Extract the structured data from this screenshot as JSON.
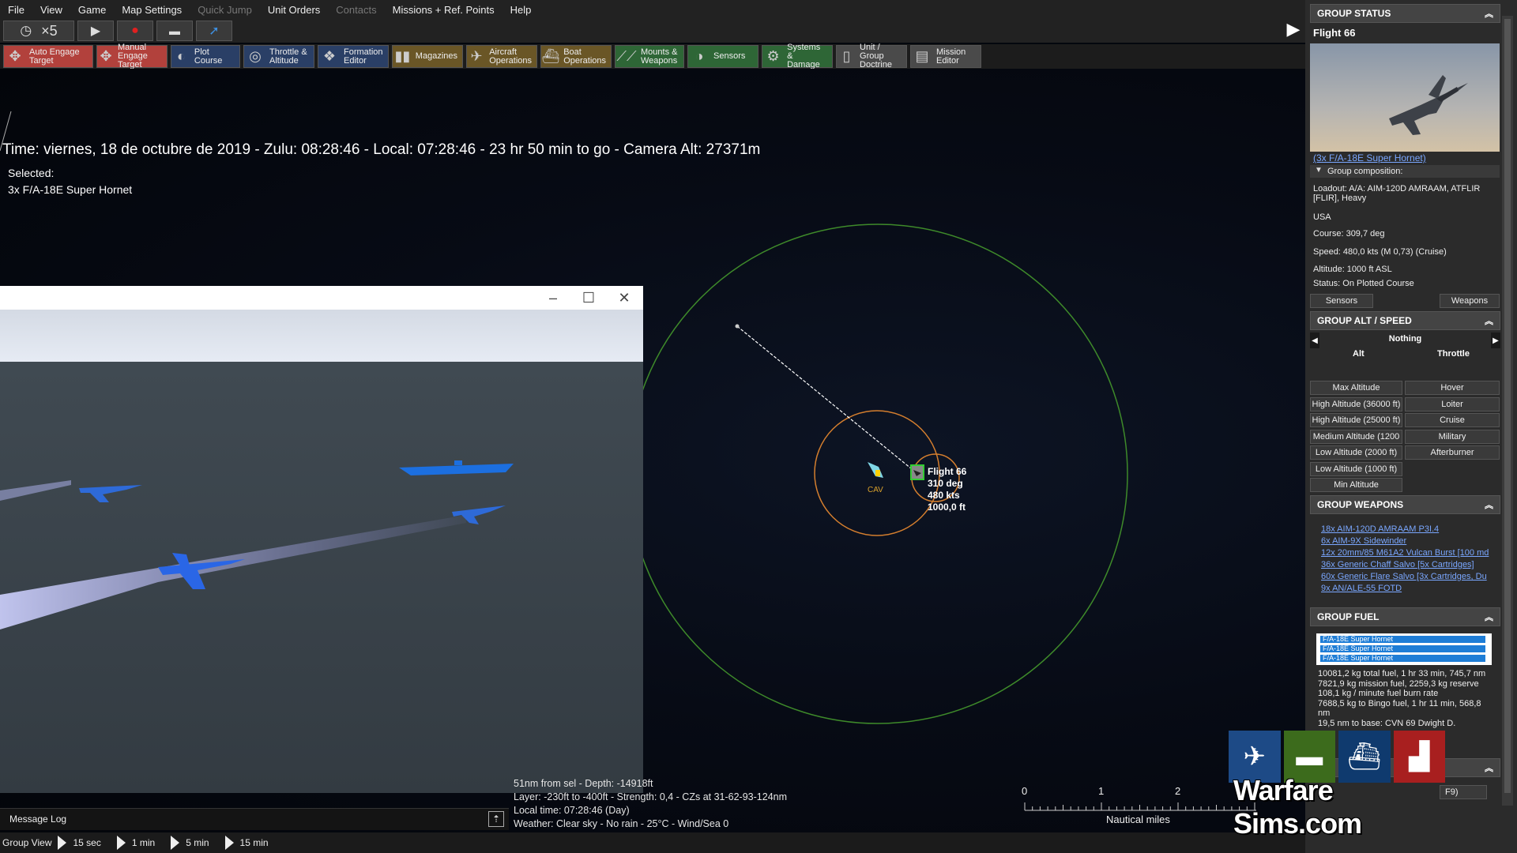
{
  "menu": {
    "items": [
      {
        "label": "File",
        "disabled": false
      },
      {
        "label": "View",
        "disabled": false
      },
      {
        "label": "Game",
        "disabled": false
      },
      {
        "label": "Map Settings",
        "disabled": false
      },
      {
        "label": "Quick Jump",
        "disabled": true
      },
      {
        "label": "Unit Orders",
        "disabled": false
      },
      {
        "label": "Contacts",
        "disabled": true
      },
      {
        "label": "Missions + Ref. Points",
        "disabled": false
      },
      {
        "label": "Help",
        "disabled": false
      }
    ]
  },
  "controls": {
    "speed_label": "×5",
    "icons": [
      "clock-icon",
      "play-icon",
      "record-icon",
      "car-icon",
      "arrow-icon"
    ]
  },
  "toolbar": {
    "buttons": [
      {
        "name": "auto-engage-target",
        "line1": "Auto Engage",
        "line2": "Target",
        "color": "#b2413c"
      },
      {
        "name": "manual-engage-target",
        "line1": "Manual",
        "line2": "Engage Target",
        "color": "#b2413c"
      },
      {
        "name": "plot-course",
        "line1": "Plot Course",
        "line2": "",
        "color": "#2a3f66"
      },
      {
        "name": "throttle-altitude",
        "line1": "Throttle &",
        "line2": "Altitude",
        "color": "#2a3f66"
      },
      {
        "name": "formation-editor",
        "line1": "Formation",
        "line2": "Editor",
        "color": "#2a3f66"
      },
      {
        "name": "magazines",
        "line1": "Magazines",
        "line2": "",
        "color": "#6a5626"
      },
      {
        "name": "aircraft-operations",
        "line1": "Aircraft",
        "line2": "Operations",
        "color": "#6a5626"
      },
      {
        "name": "boat-operations",
        "line1": "Boat",
        "line2": "Operations",
        "color": "#6a5626"
      },
      {
        "name": "mounts-weapons",
        "line1": "Mounts &",
        "line2": "Weapons",
        "color": "#2e6636"
      },
      {
        "name": "sensors",
        "line1": "Sensors",
        "line2": "",
        "color": "#2e6636"
      },
      {
        "name": "systems-damage",
        "line1": "Systems &",
        "line2": "Damage",
        "color": "#2e6636"
      },
      {
        "name": "unit-group-doctrine",
        "line1": "Unit / Group",
        "line2": "Doctrine",
        "color": "#4a4a4a"
      },
      {
        "name": "mission-editor",
        "line1": "Mission",
        "line2": "Editor",
        "color": "#4a4a4a"
      }
    ]
  },
  "map": {
    "time_line": "Time: viernes, 18 de octubre de 2019 - Zulu: 08:28:46 - Local: 07:28:46 - 23 hr 50 min to go -  Camera Alt: 27371m",
    "selected_label": "Selected:",
    "selected_units": "3x F/A-18E Super Hornet",
    "unit_label": {
      "name": "Flight 66",
      "heading": "310 deg",
      "speed": "480 kts",
      "altitude": "1000,0 ft"
    },
    "cav_label": "CAV",
    "info_lines": [
      "51nm from sel - Depth: -14918ft",
      "Layer: -230ft to -400ft - Strength: 0,4 - CZs at 31-62-93-124nm",
      "Local time: 07:28:46 (Day)",
      "Weather: Clear sky - No rain - 25°C - Wind/Sea 0"
    ],
    "scale": {
      "ticks": [
        "0",
        "1",
        "2"
      ],
      "unit": "Nautical miles"
    },
    "colors": {
      "outer_ring": "#3e8a2a",
      "inner_ring": "#d47e2e",
      "course_line": "#ffffff"
    }
  },
  "window_3d": {
    "icons": [
      "minimize-icon",
      "maximize-icon",
      "close-icon"
    ]
  },
  "message_log": {
    "label": "Message Log"
  },
  "bottom": {
    "group_view": "Group View",
    "time_steps": [
      "15 sec",
      "1 min",
      "5 min",
      "15 min"
    ]
  },
  "panel": {
    "group_status": {
      "header": "GROUP STATUS",
      "flight_name": "Flight 66",
      "composition_link": "(3x F/A-18E Super Hornet)",
      "group_composition": "Group composition:",
      "loadout": "Loadout: A/A: AIM-120D AMRAAM, ATFLIR [FLIR], Heavy",
      "country": "USA",
      "course": "Course: 309,7 deg",
      "speed": "Speed: 480,0 kts (M 0,73) (Cruise)",
      "altitude": "Altitude: 1000 ft ASL",
      "status": "Status: On Plotted Course",
      "sensors_btn": "Sensors",
      "weapons_btn": "Weapons"
    },
    "alt_speed": {
      "header": "GROUP ALT / SPEED",
      "selector": "Nothing",
      "alt_label": "Alt",
      "throttle_label": "Throttle",
      "altitudes": [
        "Max Altitude",
        "High Altitude (36000 ft)",
        "High Altitude (25000 ft)",
        "Medium Altitude (1200",
        "Low Altitude (2000 ft)",
        "Low Altitude (1000 ft)",
        "Min Altitude"
      ],
      "throttles": [
        "Hover",
        "Loiter",
        "Cruise",
        "Military",
        "Afterburner"
      ]
    },
    "weapons": {
      "header": "GROUP WEAPONS",
      "items": [
        "18x AIM-120D AMRAAM P3I.4",
        "6x AIM-9X Sidewinder",
        "12x 20mm/85 M61A2 Vulcan Burst [100 md",
        "36x Generic Chaff Salvo [5x Cartridges]",
        "60x Generic Flare Salvo [3x Cartridges, Du",
        "9x AN/ALE-55 FOTD"
      ]
    },
    "fuel": {
      "header": "GROUP FUEL",
      "bars": [
        {
          "label": "F/A-18E Super Hornet",
          "fraction": 0.97
        },
        {
          "label": "F/A-18E Super Hornet",
          "fraction": 0.97
        },
        {
          "label": "F/A-18E Super Hornet",
          "fraction": 0.97
        }
      ],
      "lines": [
        "10081,2 kg total fuel, 1 hr 33 min, 745,7 nm",
        "7821,9 kg mission fuel, 2259,3 kg reserve",
        "108,1 kg / minute fuel burn rate",
        "7688,5 kg to Bingo fuel, 1 hr 11 min, 568,8",
        "nm",
        "19,5 nm to base: CVN 69 Dwight D."
      ]
    },
    "hidden_hotkey": "F9)"
  },
  "logo": {
    "text": "Warfare Sims.com",
    "tile_colors": [
      "#1d4a86",
      "#3c6b1c",
      "#0f3a6e",
      "#a81f1f"
    ]
  }
}
